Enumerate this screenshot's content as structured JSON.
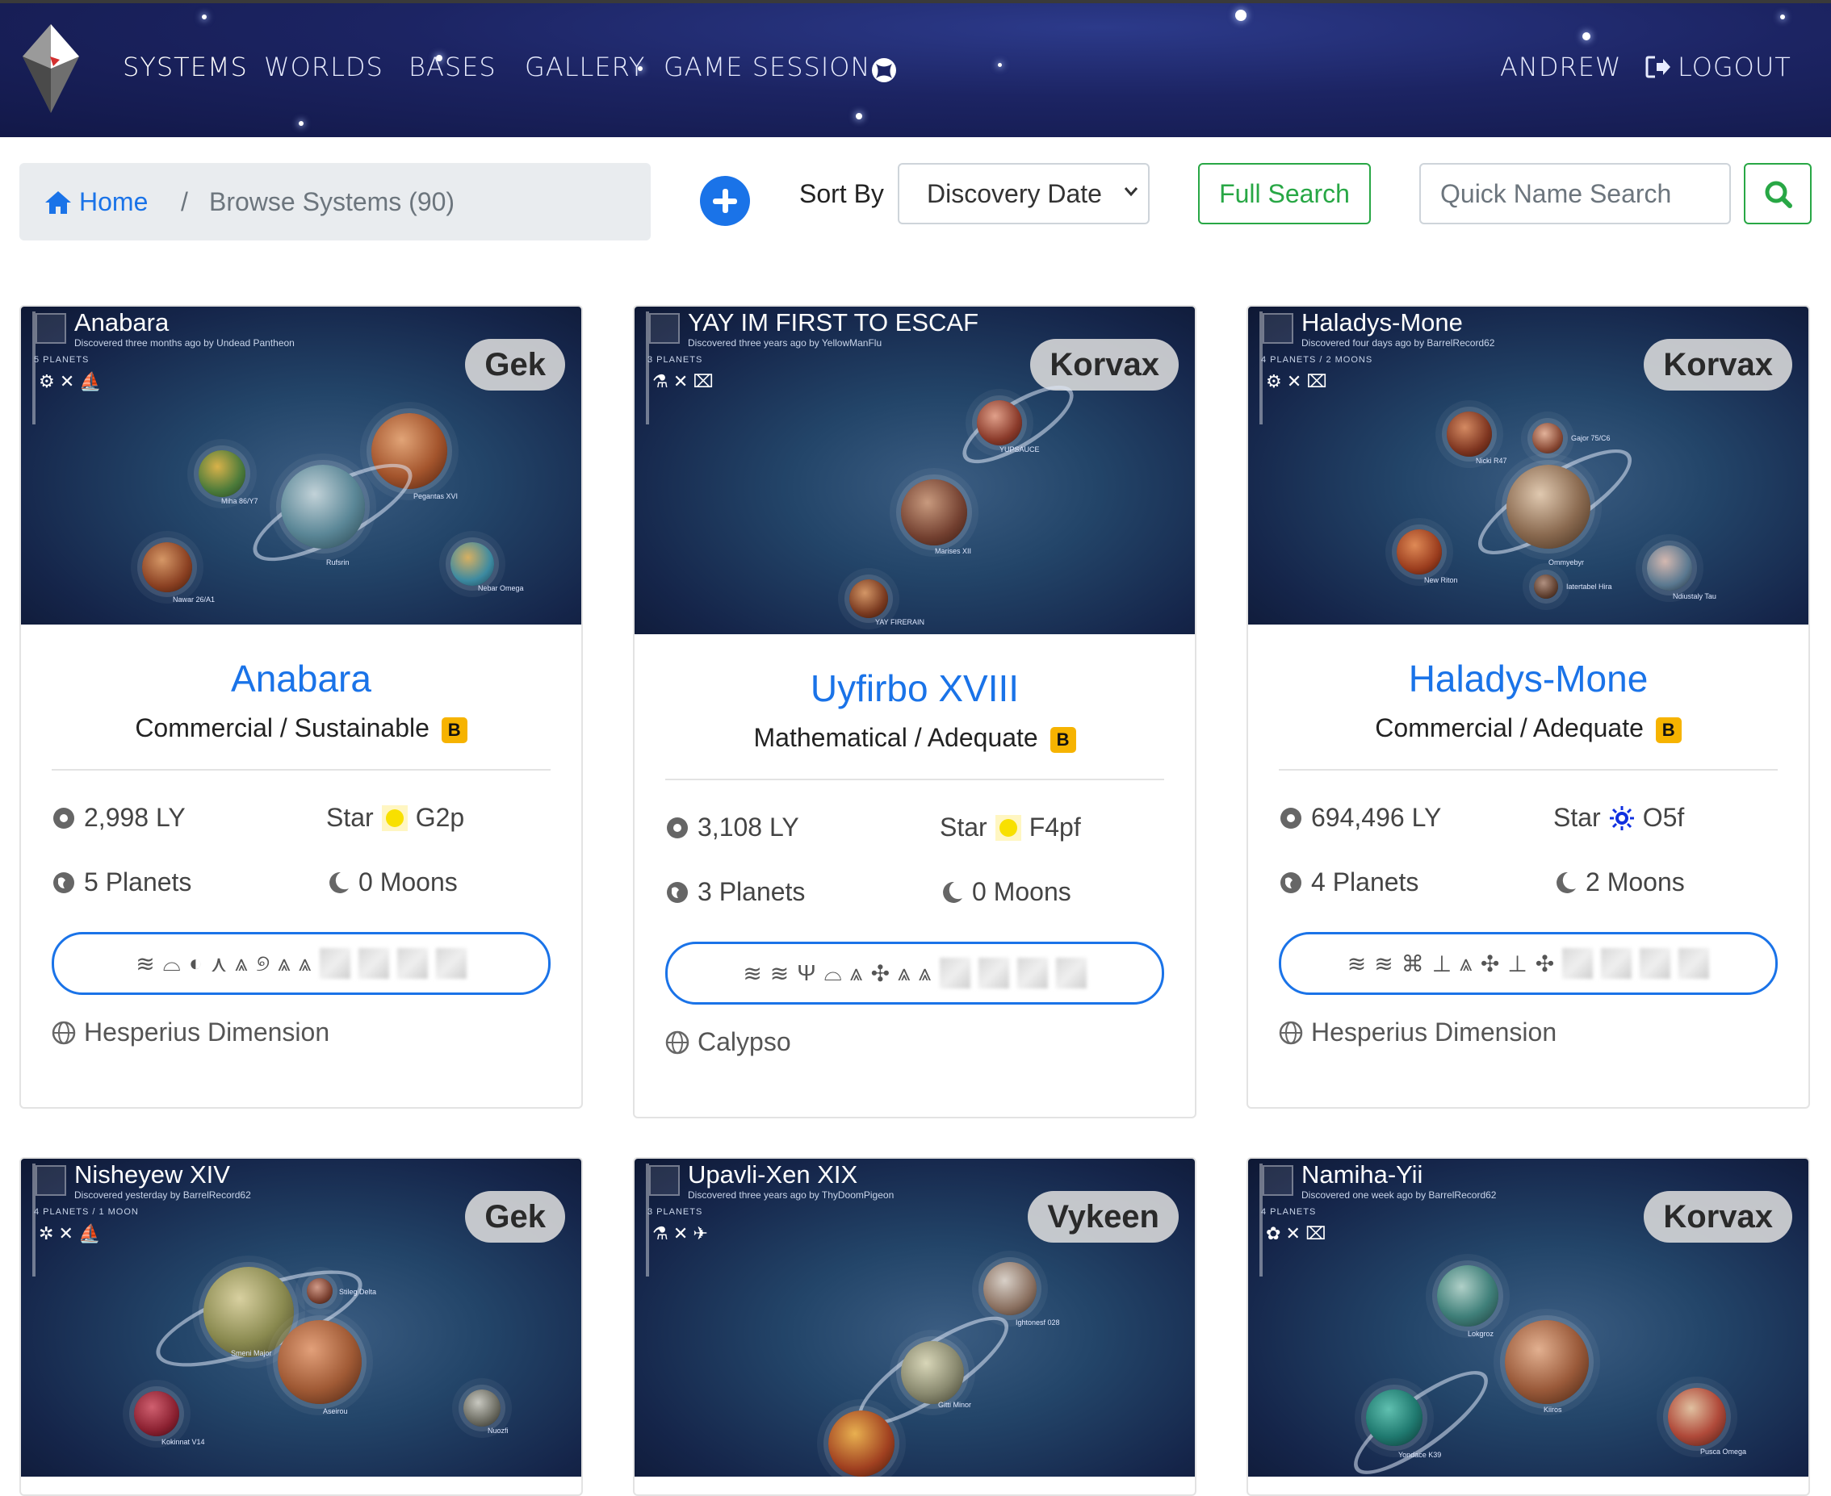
{
  "nav": {
    "items": [
      "SYSTEMS",
      "WORLDS",
      "BASES",
      "GALLERY",
      "GAME SESSION"
    ],
    "user": "ANDREW",
    "logout": "LOGOUT"
  },
  "toolbar": {
    "home": "Home",
    "separator": "/",
    "current": "Browse Systems (90)",
    "sort_label": "Sort By",
    "sort_value": "Discovery Date",
    "full_search": "Full Search",
    "quick_search_placeholder": "Quick Name Search"
  },
  "colors": {
    "accent": "#1a73e8",
    "success": "#28a745",
    "grade": "#f6b300"
  },
  "cards": [
    {
      "img_title": "Anabara",
      "img_sub": "Discovered three months ago by Undead Pantheon",
      "img_count": "5 PLANETS",
      "race": "Gek",
      "title": "Anabara",
      "economy": "Commercial / Sustainable",
      "grade": "B",
      "distance": "2,998 LY",
      "star_label": "Star",
      "star_class": "G2p",
      "star_color": "yellow",
      "planets": "5 Planets",
      "moons": "0 Moons",
      "galaxy": "Hesperius Dimension",
      "planet_labels": [
        "Miha 86/Y7",
        "Pegantas XVI",
        "Rufsrin",
        "Nawar 26/A1",
        "Nebar Omega"
      ]
    },
    {
      "img_title": "YAY IM FIRST TO ESCAF",
      "img_sub": "Discovered three years ago by YellowManFlu",
      "img_count": "3 PLANETS",
      "race": "Korvax",
      "title": "Uyfirbo XVIII",
      "economy": "Mathematical / Adequate",
      "grade": "B",
      "distance": "3,108 LY",
      "star_label": "Star",
      "star_class": "F4pf",
      "star_color": "yellow",
      "planets": "3 Planets",
      "moons": "0 Moons",
      "galaxy": "Calypso",
      "planet_labels": [
        "YUPSAUCE",
        "Marises XII",
        "YAY FIRERAIN"
      ]
    },
    {
      "img_title": "Haladys-Mone",
      "img_sub": "Discovered four days ago by BarrelRecord62",
      "img_count": "4 PLANETS / 2 MOONS",
      "race": "Korvax",
      "title": "Haladys-Mone",
      "economy": "Commercial / Adequate",
      "grade": "B",
      "distance": "694,496 LY",
      "star_label": "Star",
      "star_class": "O5f",
      "star_color": "blue",
      "planets": "4 Planets",
      "moons": "2 Moons",
      "galaxy": "Hesperius Dimension",
      "planet_labels": [
        "Nicki R47",
        "Gajor 75/C6",
        "Ommyebyr",
        "New Riton",
        "Iatertabel Hira",
        "Ndiustaly Tau"
      ]
    },
    {
      "img_title": "Nisheyew XIV",
      "img_sub": "Discovered yesterday by BarrelRecord62",
      "img_count": "4 PLANETS / 1 MOON",
      "race": "Gek",
      "planet_labels": [
        "Stileg Delta",
        "Smeni Major",
        "Aseirou",
        "Kokinnat V14",
        "Nuozfi"
      ]
    },
    {
      "img_title": "Upavli-Xen XIX",
      "img_sub": "Discovered three years ago by ThyDoomPigeon",
      "img_count": "3 PLANETS",
      "race": "Vykeen",
      "planet_labels": [
        "Ightonesf 028",
        "Gitti Minor"
      ]
    },
    {
      "img_title": "Namiha-Yii",
      "img_sub": "Discovered one week ago by BarrelRecord62",
      "img_count": "4 PLANETS",
      "race": "Korvax",
      "planet_labels": [
        "Lokgroz",
        "Kiiros",
        "Yondace K39",
        "Pusca Omega"
      ]
    }
  ]
}
